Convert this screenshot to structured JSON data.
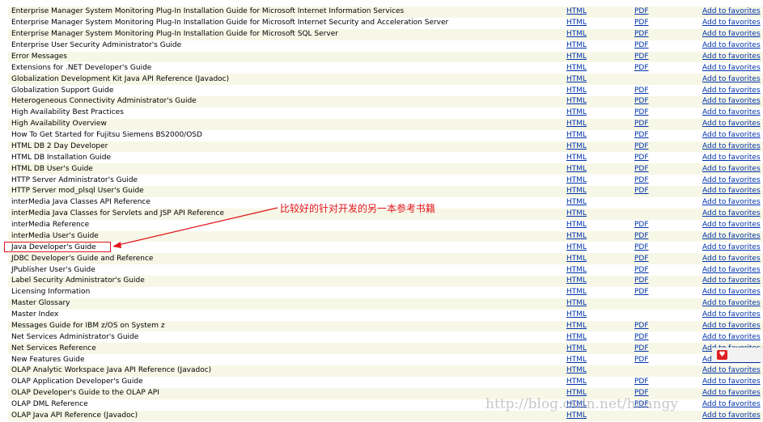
{
  "table": {
    "link_labels": {
      "html": "HTML",
      "pdf": "PDF",
      "favorites": "Add to favorites"
    },
    "rows": [
      {
        "title": "Enterprise Manager System Monitoring Plug-In Installation Guide for Microsoft Internet Information Services",
        "pdf": true
      },
      {
        "title": "Enterprise Manager System Monitoring Plug-In Installation Guide for Microsoft Internet Security and Acceleration Server",
        "pdf": true
      },
      {
        "title": "Enterprise Manager System Monitoring Plug-In Installation Guide for Microsoft SQL Server",
        "pdf": true
      },
      {
        "title": "Enterprise User Security Administrator's Guide",
        "pdf": true
      },
      {
        "title": "Error Messages",
        "pdf": true
      },
      {
        "title": "Extensions for .NET Developer's Guide",
        "pdf": true
      },
      {
        "title": "Globalization Development Kit Java API Reference (Javadoc)",
        "pdf": false
      },
      {
        "title": "Globalization Support Guide",
        "pdf": true
      },
      {
        "title": "Heterogeneous Connectivity Administrator's Guide",
        "pdf": true
      },
      {
        "title": "High Availability Best Practices",
        "pdf": true
      },
      {
        "title": "High Availability Overview",
        "pdf": true
      },
      {
        "title": "How To Get Started for Fujitsu Siemens BS2000/OSD",
        "pdf": true
      },
      {
        "title": "HTML DB 2 Day Developer",
        "pdf": true
      },
      {
        "title": "HTML DB Installation Guide",
        "pdf": true
      },
      {
        "title": "HTML DB User's Guide",
        "pdf": true
      },
      {
        "title": "HTTP Server Administrator's Guide",
        "pdf": true
      },
      {
        "title": "HTTP Server mod_plsql User's Guide",
        "pdf": true
      },
      {
        "title": "interMedia Java Classes API Reference",
        "pdf": false
      },
      {
        "title": "interMedia Java Classes for Servlets and JSP API Reference",
        "pdf": false
      },
      {
        "title": "interMedia Reference",
        "pdf": true
      },
      {
        "title": "interMedia User's Guide",
        "pdf": true
      },
      {
        "title": "Java Developer's Guide",
        "pdf": true
      },
      {
        "title": "JDBC Developer's Guide and Reference",
        "pdf": true
      },
      {
        "title": "JPublisher User's Guide",
        "pdf": true
      },
      {
        "title": "Label Security Administrator's Guide",
        "pdf": true
      },
      {
        "title": "Licensing Information",
        "pdf": true
      },
      {
        "title": "Master Glossary",
        "pdf": false
      },
      {
        "title": "Master Index",
        "pdf": false
      },
      {
        "title": "Messages Guide for IBM z/OS on System z",
        "pdf": true
      },
      {
        "title": "Net Services Administrator's Guide",
        "pdf": true
      },
      {
        "title": "Net Services Reference",
        "pdf": true
      },
      {
        "title": "New Features Guide",
        "pdf": true
      },
      {
        "title": "OLAP Analytic Workspace Java API Reference (Javadoc)",
        "pdf": false
      },
      {
        "title": "OLAP Application Developer's Guide",
        "pdf": true
      },
      {
        "title": "OLAP Developer's Guide to the OLAP API",
        "pdf": true
      },
      {
        "title": "OLAP DML Reference",
        "pdf": true
      },
      {
        "title": "OLAP Java API Reference (Javadoc)",
        "pdf": false
      }
    ]
  },
  "annotation": {
    "text": "比较好的针对开发的另一本参考书籍",
    "color": "#e0141a"
  },
  "watermark": {
    "text": "http://blog.csdn.net/huangy"
  },
  "side_widget": {
    "icon": "heart-icon"
  },
  "colors": {
    "link": "#0033aa",
    "row_alt": "#f7f7e7",
    "annotation": "#e0141a"
  }
}
